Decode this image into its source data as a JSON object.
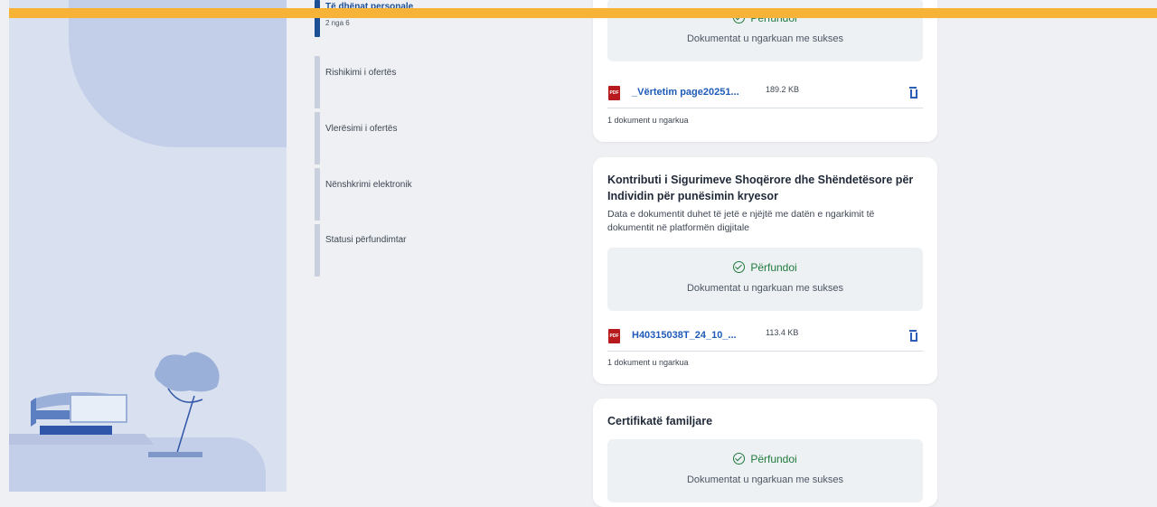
{
  "stepper": {
    "steps": [
      {
        "label": "Të dhënat personale",
        "sub": "2 nga 6",
        "active": true
      },
      {
        "label": "Rishikimi i ofertës"
      },
      {
        "label": "Vlerësimi i ofertës"
      },
      {
        "label": "Nënshkrimi elektronik"
      },
      {
        "label": "Statusi përfundimtar"
      }
    ]
  },
  "cards": [
    {
      "status": "Përfundoi",
      "status_sub": "Dokumentat u ngarkuan me sukses",
      "file": {
        "name": "_Vërtetim page20251...",
        "size": "189.2 KB",
        "icon": "PDF"
      },
      "count": "1 dokument u ngarkua"
    },
    {
      "title": "Kontributi i Sigurimeve Shoqërore dhe Shëndetësore për Individin për punësimin kryesor",
      "desc": "Data e dokumentit duhet të jetë e njëjtë me datën e ngarkimit të dokumentit në platformën digjitale",
      "status": "Përfundoi",
      "status_sub": "Dokumentat u ngarkuan me sukses",
      "file": {
        "name": "H40315038T_24_10_...",
        "size": "113.4 KB",
        "icon": "PDF"
      },
      "count": "1 dokument u ngarkua"
    },
    {
      "title": "Certifikatë familjare",
      "status": "Përfundoi",
      "status_sub": "Dokumentat u ngarkuan me sukses"
    }
  ],
  "colors": {
    "accent": "#f6b338",
    "link": "#1e5bb8",
    "success": "#1f7a3d"
  }
}
